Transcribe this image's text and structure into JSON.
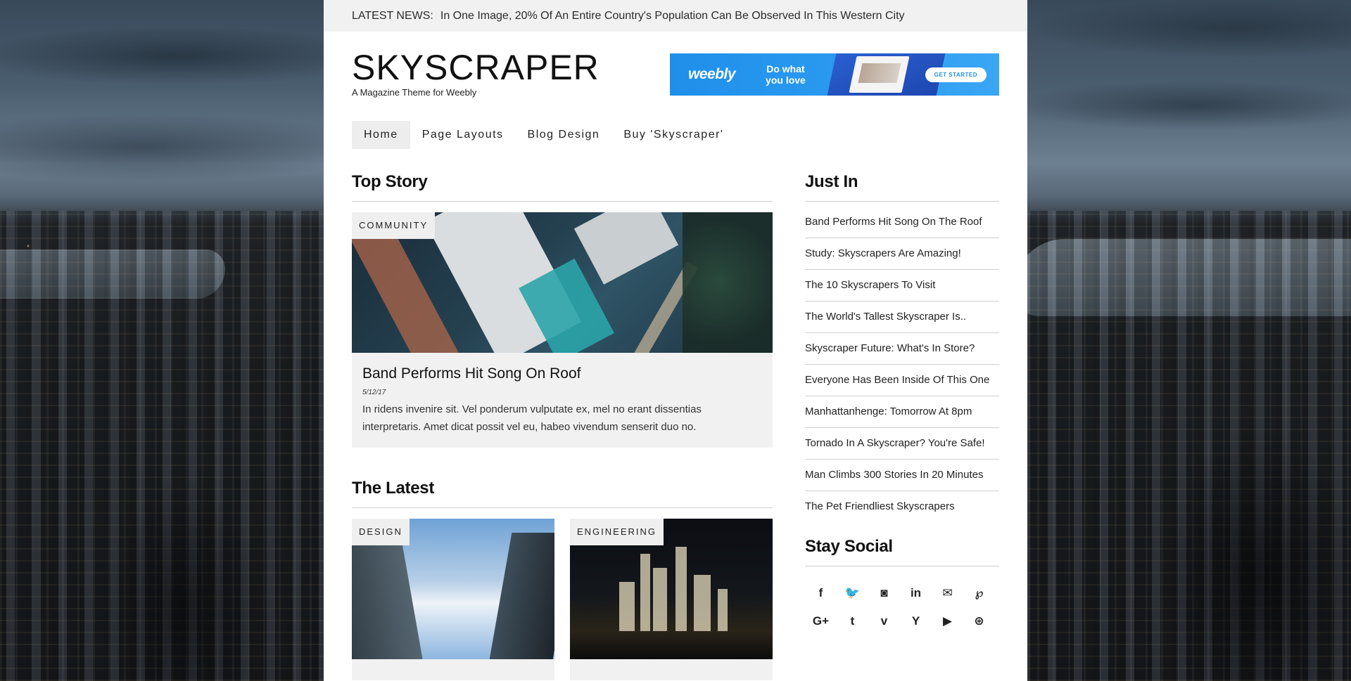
{
  "ticker": {
    "label": "LATEST NEWS:",
    "headline": "In One Image, 20% Of An Entire Country's Population Can Be Observed In This Western City"
  },
  "site": {
    "title": "SKYSCRAPER",
    "subtitle": "A Magazine Theme for Weebly"
  },
  "ad": {
    "logo": "weebly",
    "tagline_1": "Do what",
    "tagline_2": "you love",
    "cta": "GET STARTED"
  },
  "nav": {
    "items": [
      {
        "label": "Home",
        "active": true
      },
      {
        "label": "Page Layouts"
      },
      {
        "label": "Blog Design"
      },
      {
        "label": "Buy 'Skyscraper'"
      }
    ]
  },
  "top_story": {
    "heading": "Top Story",
    "category": "COMMUNITY",
    "title": "Band Performs Hit Song On Roof",
    "date": "5/12/17",
    "excerpt": "In ridens invenire sit. Vel ponderum vulputate ex, mel no erant dissentias interpretaris. Amet dicat possit vel eu, habeo vivendum senserit duo no."
  },
  "latest": {
    "heading": "The Latest",
    "cards": [
      {
        "category": "DESIGN"
      },
      {
        "category": "ENGINEERING"
      }
    ]
  },
  "just_in": {
    "heading": "Just In",
    "items": [
      "Band Performs Hit Song On The Roof",
      "Study: Skyscrapers Are Amazing!",
      "The 10 Skyscrapers To Visit",
      "The World's Tallest Skyscraper Is..",
      "Skyscraper Future: What's In Store?",
      "Everyone Has Been Inside Of This One",
      "Manhattanhenge: Tomorrow At 8pm",
      "Tornado In A Skyscraper? You're Safe!",
      "Man Climbs 300 Stories In 20 Minutes",
      "The Pet Friendliest Skyscrapers"
    ]
  },
  "social": {
    "heading": "Stay Social",
    "icons": [
      {
        "name": "facebook-icon",
        "glyph": "f"
      },
      {
        "name": "twitter-icon",
        "glyph": "🐦"
      },
      {
        "name": "instagram-icon",
        "glyph": "◙"
      },
      {
        "name": "linkedin-icon",
        "glyph": "in"
      },
      {
        "name": "email-icon",
        "glyph": "✉"
      },
      {
        "name": "pinterest-icon",
        "glyph": "℘"
      },
      {
        "name": "google-plus-icon",
        "glyph": "G+"
      },
      {
        "name": "tumblr-icon",
        "glyph": "t"
      },
      {
        "name": "vimeo-icon",
        "glyph": "v"
      },
      {
        "name": "yelp-icon",
        "glyph": "Y"
      },
      {
        "name": "youtube-icon",
        "glyph": "▶"
      },
      {
        "name": "dribbble-icon",
        "glyph": "⊛"
      }
    ]
  },
  "colors": {
    "ad_blue": "#1f8fea",
    "panel_gray": "#f1f1f1",
    "text": "#111111"
  }
}
